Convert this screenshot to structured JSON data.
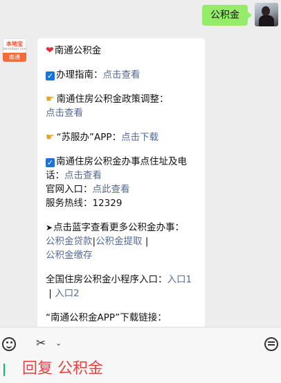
{
  "outgoing": {
    "text": "公积金"
  },
  "bot": {
    "brand": "本地宝",
    "site": "bendibao.com",
    "city": "南通"
  },
  "incoming": {
    "title": "南通公积金",
    "guide_label": "办理指南：",
    "guide_link": "点击查看",
    "policy_label": "南通住房公积金政策调整：",
    "policy_link": "点击查看",
    "app_label": "“苏服办”APP：",
    "app_link": "点击下载",
    "address_label": "南通住房公积金办事点住址及电话：",
    "address_link": "点击查看",
    "website_label": "官网入口：",
    "website_link": "点此查看",
    "hotline": "服务热线：12329",
    "more_label": "点击蓝字查看更多公积金办事：",
    "more_links": [
      "公积金贷款",
      "公积金提取",
      "公积金缴存"
    ],
    "sep": "|",
    "miniprogram_label": "全国住房公积金小程序入口：",
    "entry1": "入口1",
    "entry2": "入口2",
    "app_download_label": "“南通公积金APP”下载链接："
  },
  "input": {
    "text": "回复 公积金"
  },
  "icons": {
    "heart": "heart-icon",
    "check": "check-box-icon",
    "hand": "pointing-hand-icon",
    "arrow": "arrow-icon",
    "emoji": "emoji-icon",
    "scissors": "scissors-icon",
    "chevron": "chevron-down-icon",
    "comment": "comment-icon"
  },
  "colors": {
    "out_bubble": "#95ec69",
    "link": "#576b95",
    "input_text": "#e64340",
    "caret": "#07c160"
  }
}
